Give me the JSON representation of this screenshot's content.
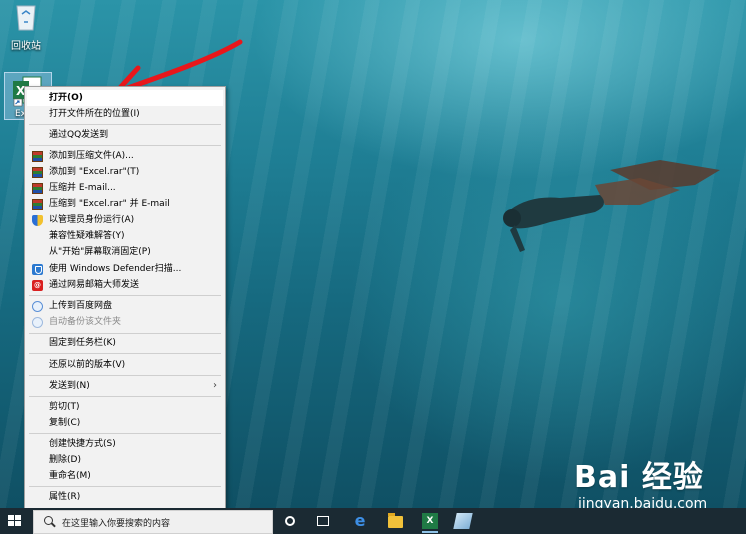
{
  "desktop": {
    "recycle_bin_label": "回收站",
    "excel_file_label": "Exc"
  },
  "context_menu": {
    "items": [
      {
        "label": "打开(O)"
      },
      {
        "label": "打开文件所在的位置(I)"
      },
      {
        "label": "通过QQ发送到"
      },
      {
        "label": "添加到压缩文件(A)..."
      },
      {
        "label": "添加到 \"Excel.rar\"(T)"
      },
      {
        "label": "压缩并 E-mail..."
      },
      {
        "label": "压缩到 \"Excel.rar\" 并 E-mail"
      },
      {
        "label": "以管理员身份运行(A)"
      },
      {
        "label": "兼容性疑难解答(Y)"
      },
      {
        "label": "从\"开始\"屏幕取消固定(P)"
      },
      {
        "label": "使用 Windows Defender扫描..."
      },
      {
        "label": "通过网易邮箱大师发送"
      },
      {
        "label": "上传到百度网盘"
      },
      {
        "label": "自动备份该文件夹"
      },
      {
        "label": "固定到任务栏(K)"
      },
      {
        "label": "还原以前的版本(V)"
      },
      {
        "label": "发送到(N)"
      },
      {
        "label": "剪切(T)"
      },
      {
        "label": "复制(C)"
      },
      {
        "label": "创建快捷方式(S)"
      },
      {
        "label": "删除(D)"
      },
      {
        "label": "重命名(M)"
      },
      {
        "label": "属性(R)"
      }
    ],
    "mail_icon_text": "@",
    "submenu_arrow": "›"
  },
  "taskbar": {
    "search_placeholder": "在这里输入你要搜索的内容",
    "excel_icon_text": "X"
  },
  "watermark": {
    "logo_text": "Bai 经验",
    "url": "jingyan.baidu.com"
  },
  "colors": {
    "accent_arrow": "#e8171b",
    "taskbar": "#1b2a33",
    "menu_bg": "#f2f2f2"
  }
}
